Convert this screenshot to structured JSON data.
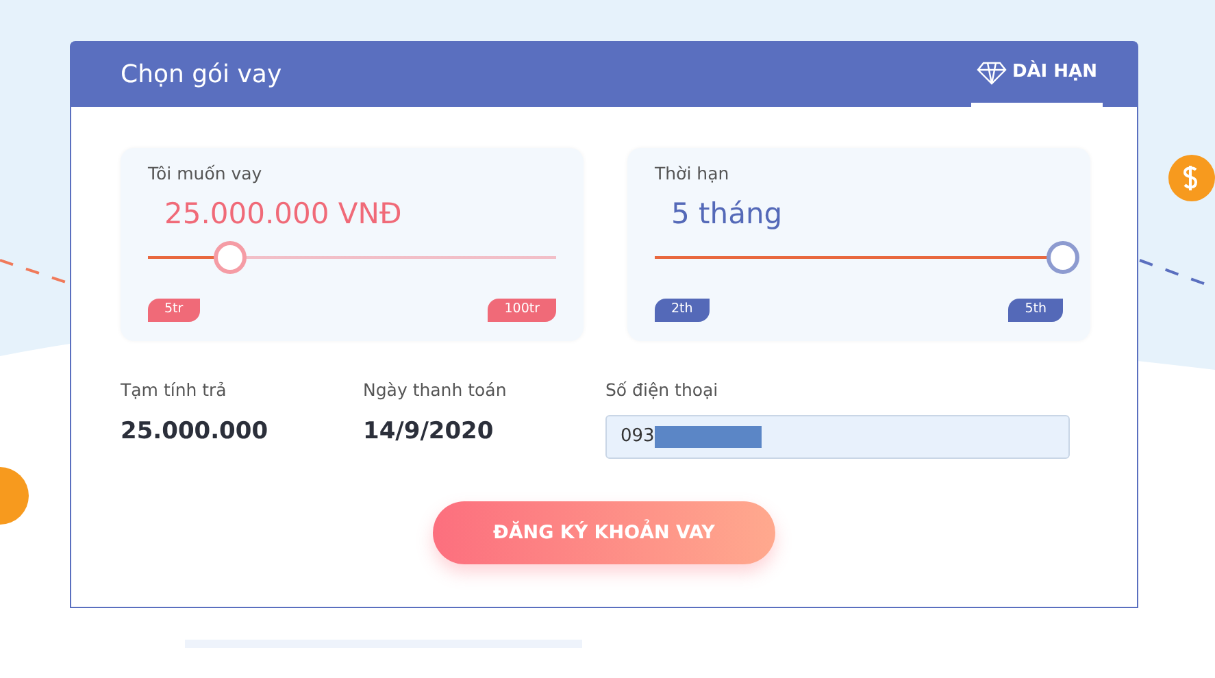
{
  "header": {
    "title": "Chọn gói vay",
    "tabs": [
      {
        "label": "DÀI HẠN",
        "selected": true
      }
    ]
  },
  "sliders": [
    {
      "label": "Tôi muốn vay",
      "value": "25.000.000 VNĐ",
      "level": 0.2,
      "min_label": "5tr",
      "max_label": "100tr",
      "color": "#f06a78"
    },
    {
      "label": "Thời hạn",
      "value": "5 tháng",
      "level": 1.0,
      "min_label": "2th",
      "max_label": "5th",
      "color": "#5469b8"
    }
  ],
  "summary": [
    {
      "label": "Tạm tính trả",
      "value": "25.000.000"
    },
    {
      "label": "Ngày thanh toán",
      "value": "14/9/2020"
    }
  ],
  "phone": {
    "label": "Số điện thoại",
    "value": "093",
    "redacted": true
  },
  "submit_button": "ĐĂNG KÝ KHOẢN VAY"
}
